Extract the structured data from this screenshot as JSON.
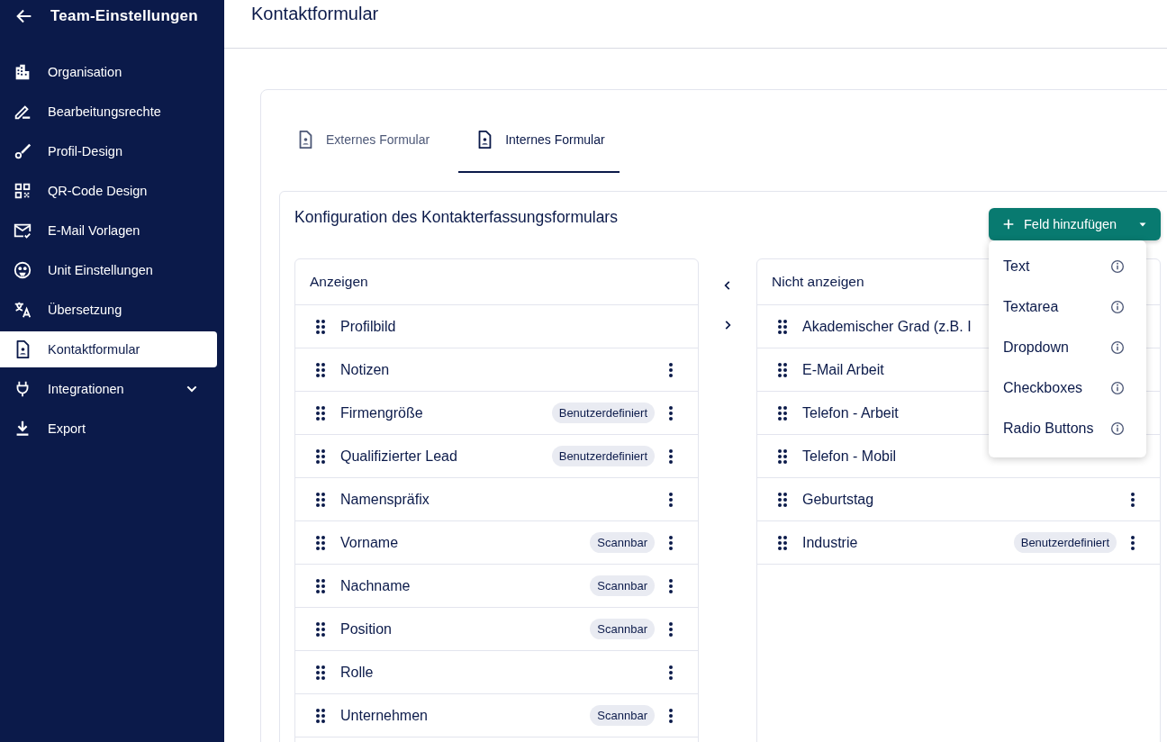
{
  "sidebar": {
    "title": "Team-Einstellungen",
    "items": [
      {
        "label": "Organisation",
        "selected": false,
        "expandable": false
      },
      {
        "label": "Bearbeitungsrechte",
        "selected": false,
        "expandable": false
      },
      {
        "label": "Profil-Design",
        "selected": false,
        "expandable": false
      },
      {
        "label": "QR-Code Design",
        "selected": false,
        "expandable": false
      },
      {
        "label": "E-Mail Vorlagen",
        "selected": false,
        "expandable": false
      },
      {
        "label": "Unit Einstellungen",
        "selected": false,
        "expandable": false
      },
      {
        "label": "Übersetzung",
        "selected": false,
        "expandable": false
      },
      {
        "label": "Kontaktformular",
        "selected": true,
        "expandable": false
      },
      {
        "label": "Integrationen",
        "selected": false,
        "expandable": true
      },
      {
        "label": "Export",
        "selected": false,
        "expandable": false
      }
    ]
  },
  "header": {
    "title": "Kontaktformular"
  },
  "tabs": [
    {
      "label": "Externes Formular",
      "selected": false
    },
    {
      "label": "Internes Formular",
      "selected": true
    }
  ],
  "config": {
    "title": "Konfiguration des Kontakterfassungsformulars",
    "add_button": {
      "label": "Feld hinzufügen",
      "expanded": true,
      "menu": [
        "Text",
        "Textarea",
        "Dropdown",
        "Checkboxes",
        "Radio Buttons"
      ]
    },
    "shown": {
      "title": "Anzeigen",
      "rows": [
        {
          "label": "Profilbild",
          "tag": null,
          "has_menu": false
        },
        {
          "label": "Notizen",
          "tag": null,
          "has_menu": true
        },
        {
          "label": "Firmengröße",
          "tag": "Benutzerdefiniert",
          "has_menu": true
        },
        {
          "label": "Qualifizierter Lead",
          "tag": "Benutzerdefiniert",
          "has_menu": true
        },
        {
          "label": "Namenspräfix",
          "tag": null,
          "has_menu": true
        },
        {
          "label": "Vorname",
          "tag": "Scannbar",
          "has_menu": true
        },
        {
          "label": "Nachname",
          "tag": "Scannbar",
          "has_menu": true
        },
        {
          "label": "Position",
          "tag": "Scannbar",
          "has_menu": true
        },
        {
          "label": "Rolle",
          "tag": null,
          "has_menu": true
        },
        {
          "label": "Unternehmen",
          "tag": "Scannbar",
          "has_menu": true
        }
      ]
    },
    "hidden": {
      "title": "Nicht anzeigen",
      "rows": [
        {
          "label": "Akademischer Grad (z.B. I",
          "tag": null,
          "has_menu": false
        },
        {
          "label": "E-Mail Arbeit",
          "tag": null,
          "has_menu": false
        },
        {
          "label": "Telefon - Arbeit",
          "tag": null,
          "has_menu": false
        },
        {
          "label": "Telefon - Mobil",
          "tag": null,
          "has_menu": false
        },
        {
          "label": "Geburtstag",
          "tag": null,
          "has_menu": true
        },
        {
          "label": "Industrie",
          "tag": "Benutzerdefiniert",
          "has_menu": true
        }
      ]
    }
  }
}
